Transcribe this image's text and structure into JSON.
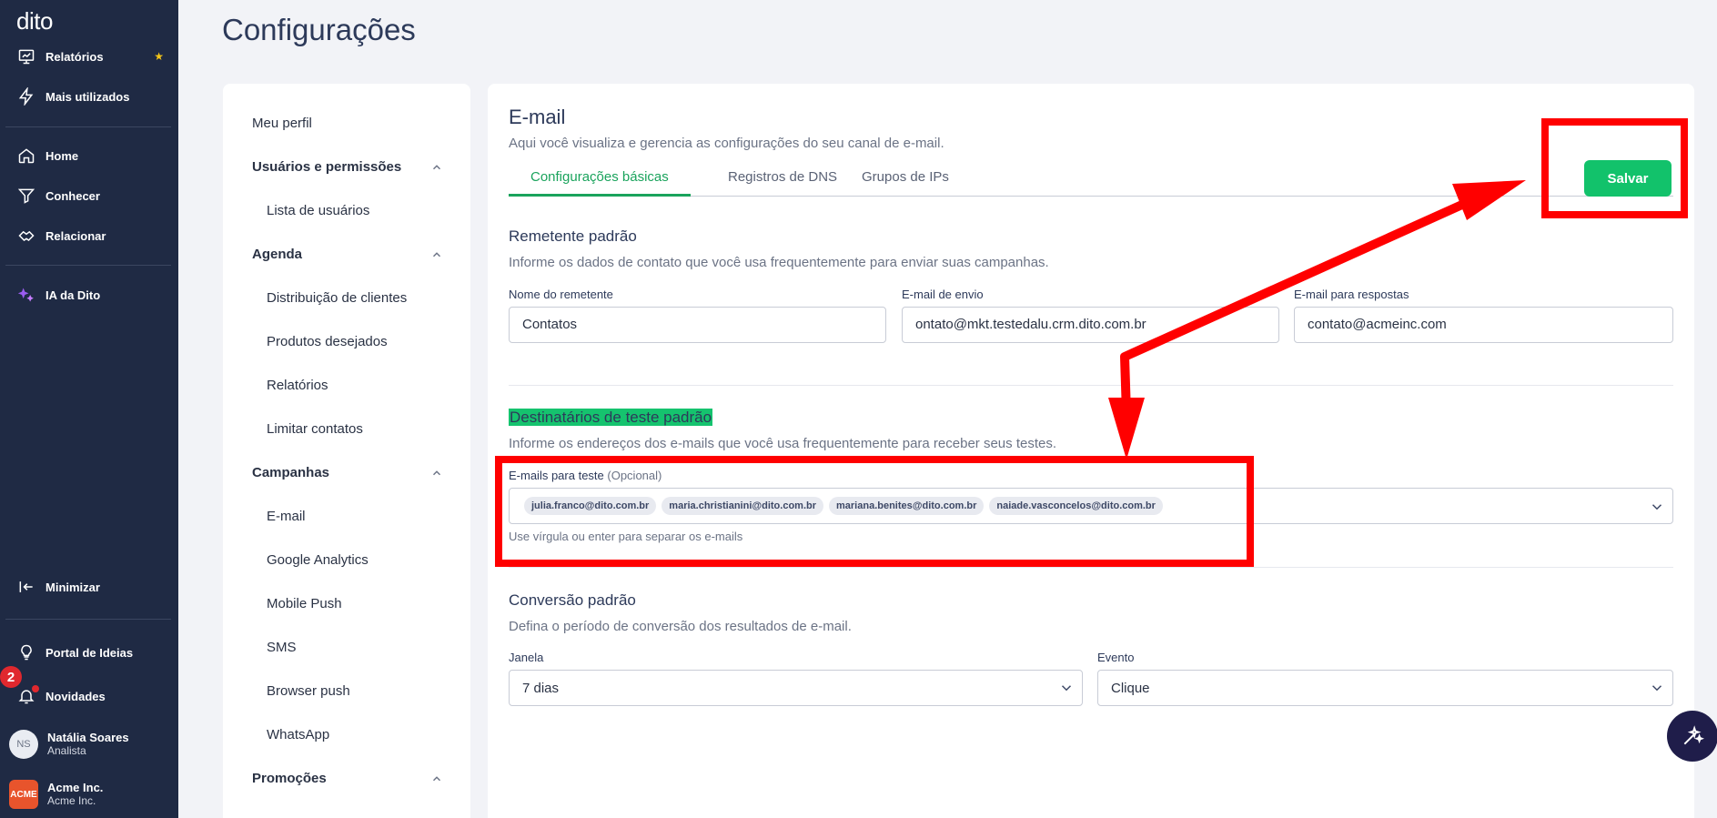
{
  "app": {
    "logo": "dito",
    "page_title": "Configurações"
  },
  "sidebar": {
    "items": [
      {
        "label": "Relatórios",
        "icon": "report-icon"
      },
      {
        "label": "Mais utilizados",
        "icon": "bolt-icon"
      },
      {
        "label": "Home",
        "icon": "home-icon"
      },
      {
        "label": "Conhecer",
        "icon": "funnel-icon"
      },
      {
        "label": "Relacionar",
        "icon": "handshake-icon"
      },
      {
        "label": "IA da Dito",
        "icon": "sparkle-icon"
      },
      {
        "label": "Minimizar",
        "icon": "collapse-icon"
      },
      {
        "label": "Portal de Ideias",
        "icon": "bulb-icon"
      },
      {
        "label": "Novidades",
        "icon": "bell-icon"
      }
    ],
    "notifications_count": "2",
    "user": {
      "initials": "NS",
      "name": "Natália Soares",
      "role": "Analista"
    },
    "org": {
      "logo": "ACME",
      "name": "Acme Inc.",
      "sub": "Acme Inc."
    },
    "accent_color": "#f5c518"
  },
  "settings_nav": {
    "meu_perfil": "Meu perfil",
    "usuarios": {
      "label": "Usuários e permissões",
      "items": [
        "Lista de usuários"
      ]
    },
    "agenda": {
      "label": "Agenda",
      "items": [
        "Distribuição de clientes",
        "Produtos desejados",
        "Relatórios",
        "Limitar contatos"
      ]
    },
    "campanhas": {
      "label": "Campanhas",
      "items": [
        "E-mail",
        "Google Analytics",
        "Mobile Push",
        "SMS",
        "Browser push",
        "WhatsApp"
      ]
    },
    "promocoes": {
      "label": "Promoções"
    }
  },
  "email": {
    "title": "E-mail",
    "description": "Aqui você visualiza e gerencia as configurações do seu canal de e-mail.",
    "save_label": "Salvar",
    "tabs": [
      "Configurações básicas",
      "Registros de DNS",
      "Grupos de IPs"
    ],
    "active_tab": "Configurações básicas",
    "sender": {
      "title": "Remetente padrão",
      "description": "Informe os dados de contato que você usa frequentemente para enviar suas campanhas.",
      "name_label": "Nome do remetente",
      "name_value": "Contatos",
      "from_label": "E-mail de envio",
      "from_value": "ontato@mkt.testedalu.crm.dito.com.br",
      "reply_label": "E-mail para respostas",
      "reply_value": "contato@acmeinc.com"
    },
    "test_recipients": {
      "title": "Destinatários de teste padrão",
      "description": "Informe os endereços dos e-mails que você usa frequentemente para receber seus testes.",
      "field_label": "E-mails para teste",
      "optional": "(Opcional)",
      "chips": [
        "julia.franco@dito.com.br",
        "maria.christianini@dito.com.br",
        "mariana.benites@dito.com.br",
        "naiade.vasconcelos@dito.com.br"
      ],
      "hint": "Use vírgula ou enter para separar os e-mails"
    },
    "conversion": {
      "title": "Conversão padrão",
      "description": "Defina o período de conversão dos resultados de e-mail.",
      "window_label": "Janela",
      "window_value": "7 dias",
      "event_label": "Evento",
      "event_value": "Clique"
    }
  },
  "colors": {
    "primary_green": "#12c26b",
    "sidebar_bg": "#1f2a44",
    "annotation_red": "#ff0000"
  }
}
